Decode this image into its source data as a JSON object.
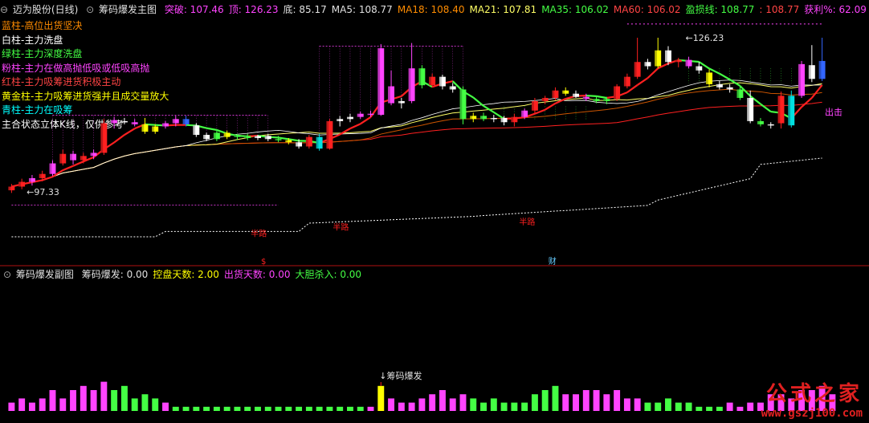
{
  "main_header": {
    "title": "迈为股份(日线)",
    "indicator_name": "筹码爆发主图",
    "items": [
      {
        "label": "突破:",
        "value": "107.46",
        "color": "#ff44ff"
      },
      {
        "label": "顶:",
        "value": "126.23",
        "color": "#ff44ff"
      },
      {
        "label": "底:",
        "value": "85.17",
        "color": "#e0e0e0"
      },
      {
        "label": "MA5:",
        "value": "108.77",
        "color": "#e0e0e0"
      },
      {
        "label": "MA18:",
        "value": "108.40",
        "color": "#ff8c00"
      },
      {
        "label": "MA21:",
        "value": "107.81",
        "color": "#ffff66"
      },
      {
        "label": "MA35:",
        "value": "106.02",
        "color": "#44ff44"
      },
      {
        "label": "MA60:",
        "value": "106.02",
        "color": "#ff4444"
      },
      {
        "label": "盈损线:",
        "value": "108.77",
        "color": "#44ff44"
      },
      {
        "label": ":",
        "value": "108.77",
        "color": "#ff4444"
      },
      {
        "label": "获利%:",
        "value": "62.09",
        "color": "#ff44ff"
      }
    ]
  },
  "legend": [
    {
      "text": "蓝柱-高位出货坚决",
      "color": "#ff8c00"
    },
    {
      "text": "白柱-主力洗盘",
      "color": "#ffffff"
    },
    {
      "text": "绿柱-主力深度洗盘",
      "color": "#44ff44"
    },
    {
      "text": "粉柱-主力在做高抛低吸或低吸高抛",
      "color": "#ff44ff"
    },
    {
      "text": "红柱-主力吸筹进货积极主动",
      "color": "#ff4444"
    },
    {
      "text": "黄金柱-主力吸筹进货强并且成交量放大",
      "color": "#ffff00"
    },
    {
      "text": "青柱-主力在吸筹",
      "color": "#00ffff"
    },
    {
      "text": "主合状态立体K线，仅供参考",
      "color": "#ffffff"
    }
  ],
  "sub_header": {
    "indicator_name": "筹码爆发副图",
    "items": [
      {
        "label": "筹码爆发:",
        "value": "0.00",
        "color": "#e0e0e0"
      },
      {
        "label": "控盘天数:",
        "value": "2.00",
        "color": "#ffff00"
      },
      {
        "label": "出货天数:",
        "value": "0.00",
        "color": "#ff44ff"
      },
      {
        "label": "大胆杀入:",
        "value": "0.00",
        "color": "#44ff44"
      }
    ]
  },
  "annotations": {
    "low_price": "97.33",
    "high_price": "126.23",
    "half_way_1": "半路",
    "half_way_2": "半路",
    "half_way_3": "半路",
    "dollar_marker": "$",
    "cai_marker": "财",
    "chu_ji": "出击",
    "burst_label": "筹码爆发"
  },
  "watermark": {
    "logo": "公式之家",
    "url": "www.gszj100.com"
  },
  "colors": {
    "ma_red": "#ff2020",
    "ma_green": "#44ff44",
    "ma_yellow": "#ffff66",
    "ma_orange": "#ff8c00",
    "magenta": "#ff44ff",
    "white": "#e0e0e0",
    "cyan": "#00e0e0",
    "divider": "#b01010"
  },
  "chart_data": [
    {
      "type": "candlestick",
      "title": "筹码爆发主图",
      "y_range": [
        85,
        130
      ],
      "candles": [
        {
          "o": 97.3,
          "h": 98.5,
          "l": 96.8,
          "c": 98.0,
          "color": "#ff2020"
        },
        {
          "o": 98.0,
          "h": 99.5,
          "l": 97.5,
          "c": 98.9,
          "color": "#ff2020"
        },
        {
          "o": 98.9,
          "h": 100.2,
          "l": 98.2,
          "c": 99.6,
          "color": "#ff44ff"
        },
        {
          "o": 99.6,
          "h": 101.0,
          "l": 99.0,
          "c": 100.4,
          "color": "#ff2020"
        },
        {
          "o": 100.4,
          "h": 103.0,
          "l": 100.0,
          "c": 102.4,
          "color": "#ff44ff"
        },
        {
          "o": 102.4,
          "h": 105.0,
          "l": 102.0,
          "c": 104.2,
          "color": "#ff2020"
        },
        {
          "o": 104.2,
          "h": 104.8,
          "l": 102.2,
          "c": 103.0,
          "color": "#ff44ff"
        },
        {
          "o": 103.0,
          "h": 104.4,
          "l": 102.4,
          "c": 103.8,
          "color": "#ff2020"
        },
        {
          "o": 103.8,
          "h": 105.0,
          "l": 103.2,
          "c": 104.4,
          "color": "#ff44ff"
        },
        {
          "o": 104.4,
          "h": 110.8,
          "l": 104.0,
          "c": 110.0,
          "color": "#ff2020"
        },
        {
          "o": 110.0,
          "h": 111.2,
          "l": 109.0,
          "c": 110.6,
          "color": "#ff44ff"
        },
        {
          "o": 110.4,
          "h": 111.0,
          "l": 109.8,
          "c": 110.2,
          "color": "#ffffff"
        },
        {
          "o": 110.2,
          "h": 110.8,
          "l": 109.4,
          "c": 109.8,
          "color": "#ff44ff"
        },
        {
          "o": 109.8,
          "h": 111.0,
          "l": 108.0,
          "c": 108.4,
          "color": "#ffff00"
        },
        {
          "o": 108.4,
          "h": 109.8,
          "l": 108.0,
          "c": 109.4,
          "color": "#ffff00"
        },
        {
          "o": 109.4,
          "h": 110.4,
          "l": 109.0,
          "c": 110.0,
          "color": "#ff44ff"
        },
        {
          "o": 110.0,
          "h": 111.4,
          "l": 109.4,
          "c": 110.8,
          "color": "#ff44ff"
        },
        {
          "o": 110.8,
          "h": 111.4,
          "l": 109.4,
          "c": 109.8,
          "color": "#3366ff"
        },
        {
          "o": 109.6,
          "h": 110.0,
          "l": 107.4,
          "c": 107.8,
          "color": "#ffffff"
        },
        {
          "o": 107.8,
          "h": 108.2,
          "l": 106.6,
          "c": 107.0,
          "color": "#ffffff"
        },
        {
          "o": 107.0,
          "h": 108.6,
          "l": 106.6,
          "c": 108.2,
          "color": "#44ff44"
        },
        {
          "o": 108.2,
          "h": 108.6,
          "l": 107.0,
          "c": 107.4,
          "color": "#ffff00"
        },
        {
          "o": 107.4,
          "h": 108.0,
          "l": 106.8,
          "c": 107.8,
          "color": "#44ff44"
        },
        {
          "o": 107.6,
          "h": 108.0,
          "l": 106.8,
          "c": 107.2,
          "color": "#44ff44"
        },
        {
          "o": 107.2,
          "h": 107.8,
          "l": 106.8,
          "c": 107.6,
          "color": "#ffffff"
        },
        {
          "o": 107.6,
          "h": 108.0,
          "l": 106.6,
          "c": 107.0,
          "color": "#ffffff"
        },
        {
          "o": 107.0,
          "h": 107.6,
          "l": 106.4,
          "c": 106.8,
          "color": "#44ff44"
        },
        {
          "o": 106.8,
          "h": 107.2,
          "l": 106.0,
          "c": 106.4,
          "color": "#ffff00"
        },
        {
          "o": 106.4,
          "h": 107.0,
          "l": 105.2,
          "c": 105.6,
          "color": "#ffffff"
        },
        {
          "o": 105.6,
          "h": 107.8,
          "l": 105.2,
          "c": 107.4,
          "color": "#ff2020"
        },
        {
          "o": 107.4,
          "h": 108.0,
          "l": 104.8,
          "c": 105.2,
          "color": "#00e0e0"
        },
        {
          "o": 105.2,
          "h": 110.8,
          "l": 105.0,
          "c": 110.4,
          "color": "#ff2020"
        },
        {
          "o": 110.4,
          "h": 111.4,
          "l": 109.4,
          "c": 110.8,
          "color": "#ffffff"
        },
        {
          "o": 110.8,
          "h": 111.8,
          "l": 110.2,
          "c": 111.2,
          "color": "#ffffff"
        },
        {
          "o": 111.2,
          "h": 112.2,
          "l": 110.8,
          "c": 111.8,
          "color": "#ff44ff"
        },
        {
          "o": 111.8,
          "h": 112.4,
          "l": 111.2,
          "c": 111.6,
          "color": "#ff44ff"
        },
        {
          "o": 111.6,
          "h": 125.0,
          "l": 111.4,
          "c": 124.2,
          "color": "#ff44ff"
        },
        {
          "o": 117.0,
          "h": 120.0,
          "l": 113.4,
          "c": 113.8,
          "color": "#ff44ff"
        },
        {
          "o": 113.8,
          "h": 114.8,
          "l": 112.8,
          "c": 114.2,
          "color": "#ffffff"
        },
        {
          "o": 114.2,
          "h": 125.2,
          "l": 113.8,
          "c": 120.4,
          "color": "#ff44ff"
        },
        {
          "o": 120.4,
          "h": 121.0,
          "l": 116.6,
          "c": 117.2,
          "color": "#44ff44"
        },
        {
          "o": 117.2,
          "h": 119.4,
          "l": 116.8,
          "c": 118.8,
          "color": "#ff2020"
        },
        {
          "o": 118.8,
          "h": 119.2,
          "l": 116.4,
          "c": 117.0,
          "color": "#ffffff"
        },
        {
          "o": 117.0,
          "h": 117.6,
          "l": 115.8,
          "c": 116.4,
          "color": "#ffffff"
        },
        {
          "o": 116.4,
          "h": 117.0,
          "l": 109.8,
          "c": 110.8,
          "color": "#44ff44"
        },
        {
          "o": 110.8,
          "h": 112.0,
          "l": 110.2,
          "c": 111.4,
          "color": "#ffff00"
        },
        {
          "o": 111.4,
          "h": 112.0,
          "l": 110.4,
          "c": 110.8,
          "color": "#44ff44"
        },
        {
          "o": 110.8,
          "h": 111.6,
          "l": 110.2,
          "c": 111.0,
          "color": "#ffffff"
        },
        {
          "o": 111.0,
          "h": 111.4,
          "l": 109.6,
          "c": 110.2,
          "color": "#ffffff"
        },
        {
          "o": 110.2,
          "h": 111.8,
          "l": 109.4,
          "c": 111.2,
          "color": "#ff2020"
        },
        {
          "o": 111.2,
          "h": 112.8,
          "l": 110.8,
          "c": 112.4,
          "color": "#ff44ff"
        },
        {
          "o": 112.4,
          "h": 114.8,
          "l": 111.8,
          "c": 114.2,
          "color": "#ff2020"
        },
        {
          "o": 114.2,
          "h": 115.2,
          "l": 113.6,
          "c": 114.8,
          "color": "#ff2020"
        },
        {
          "o": 114.8,
          "h": 116.8,
          "l": 114.4,
          "c": 116.2,
          "color": "#ff2020"
        },
        {
          "o": 116.2,
          "h": 116.8,
          "l": 115.2,
          "c": 115.6,
          "color": "#ffff00"
        },
        {
          "o": 115.6,
          "h": 116.2,
          "l": 114.8,
          "c": 115.0,
          "color": "#ffffff"
        },
        {
          "o": 115.0,
          "h": 115.6,
          "l": 114.2,
          "c": 114.6,
          "color": "#ff44ff"
        },
        {
          "o": 114.6,
          "h": 115.2,
          "l": 113.8,
          "c": 114.2,
          "color": "#44ff44"
        },
        {
          "o": 114.2,
          "h": 115.0,
          "l": 113.6,
          "c": 114.6,
          "color": "#44ff44"
        },
        {
          "o": 114.6,
          "h": 117.4,
          "l": 114.2,
          "c": 117.0,
          "color": "#ff2020"
        },
        {
          "o": 117.0,
          "h": 119.4,
          "l": 116.6,
          "c": 118.8,
          "color": "#ff2020"
        },
        {
          "o": 118.8,
          "h": 126.2,
          "l": 118.4,
          "c": 121.6,
          "color": "#ff2020"
        },
        {
          "o": 121.6,
          "h": 122.2,
          "l": 120.2,
          "c": 120.8,
          "color": "#ffffff"
        },
        {
          "o": 120.8,
          "h": 126.2,
          "l": 120.4,
          "c": 123.8,
          "color": "#ffff00"
        },
        {
          "o": 123.8,
          "h": 124.6,
          "l": 121.0,
          "c": 121.6,
          "color": "#ffffff"
        },
        {
          "o": 121.6,
          "h": 122.4,
          "l": 120.6,
          "c": 122.0,
          "color": "#ff2020"
        },
        {
          "o": 122.0,
          "h": 122.6,
          "l": 120.4,
          "c": 120.8,
          "color": "#ff44ff"
        },
        {
          "o": 120.8,
          "h": 121.6,
          "l": 119.4,
          "c": 120.0,
          "color": "#ffffff"
        },
        {
          "o": 119.6,
          "h": 120.2,
          "l": 116.8,
          "c": 117.4,
          "color": "#ffff00"
        },
        {
          "o": 117.4,
          "h": 118.0,
          "l": 116.4,
          "c": 116.8,
          "color": "#ffffff"
        },
        {
          "o": 116.8,
          "h": 117.4,
          "l": 115.8,
          "c": 116.4,
          "color": "#ffffff"
        },
        {
          "o": 116.4,
          "h": 117.0,
          "l": 114.4,
          "c": 114.8,
          "color": "#44ff44"
        },
        {
          "o": 114.8,
          "h": 116.2,
          "l": 110.0,
          "c": 110.4,
          "color": "#ffffff"
        },
        {
          "o": 110.4,
          "h": 111.0,
          "l": 109.4,
          "c": 109.8,
          "color": "#44ff44"
        },
        {
          "o": 109.8,
          "h": 110.2,
          "l": 109.0,
          "c": 109.6,
          "color": "#ffffff"
        },
        {
          "o": 110.0,
          "h": 116.0,
          "l": 109.0,
          "c": 115.2,
          "color": "#ff2020"
        },
        {
          "o": 115.2,
          "h": 116.2,
          "l": 109.2,
          "c": 109.6,
          "color": "#00e0e0"
        },
        {
          "o": 115.2,
          "h": 121.8,
          "l": 114.8,
          "c": 121.2,
          "color": "#ff44ff"
        },
        {
          "o": 121.0,
          "h": 124.8,
          "l": 117.8,
          "c": 118.4,
          "color": "#ffffff"
        },
        {
          "o": 118.4,
          "h": 126.2,
          "l": 118.0,
          "c": 121.8,
          "color": "#3366ff"
        }
      ],
      "annotations": {
        "high": "126.23",
        "low": "97.33"
      }
    },
    {
      "type": "bar",
      "title": "筹码爆发副图",
      "series": [
        {
          "values": [
            2,
            3,
            2,
            3,
            5,
            3,
            5,
            6,
            5,
            7,
            5,
            6,
            3,
            4,
            3,
            2,
            1,
            1,
            1,
            1,
            1,
            1,
            1,
            1,
            1,
            1,
            1,
            1,
            1,
            1,
            1,
            1,
            1,
            1,
            1,
            1,
            6,
            3,
            2,
            2,
            3,
            4,
            5,
            3,
            4,
            3,
            2,
            3,
            2,
            2,
            2,
            4,
            5,
            6,
            4,
            4,
            5,
            5,
            4,
            5,
            3,
            3,
            2,
            2,
            3,
            2,
            2,
            1,
            1,
            1,
            2,
            1,
            2,
            2,
            4,
            4,
            3,
            5,
            5,
            6,
            4
          ],
          "colors": [
            "#ff44ff",
            "#ff44ff",
            "#ff44ff",
            "#ff44ff",
            "#ff44ff",
            "#ff44ff",
            "#ff44ff",
            "#ff44ff",
            "#ff44ff",
            "#ff44ff",
            "#44ff44",
            "#44ff44",
            "#44ff44",
            "#44ff44",
            "#44ff44",
            "#ff44ff",
            "#44ff44",
            "#44ff44",
            "#44ff44",
            "#44ff44",
            "#44ff44",
            "#44ff44",
            "#44ff44",
            "#44ff44",
            "#44ff44",
            "#44ff44",
            "#44ff44",
            "#44ff44",
            "#44ff44",
            "#44ff44",
            "#44ff44",
            "#44ff44",
            "#44ff44",
            "#44ff44",
            "#44ff44",
            "#ff44ff",
            "#ffff00",
            "#ff44ff",
            "#ff44ff",
            "#ff44ff",
            "#ff44ff",
            "#ff44ff",
            "#ff44ff",
            "#ff44ff",
            "#ff44ff",
            "#44ff44",
            "#44ff44",
            "#44ff44",
            "#44ff44",
            "#44ff44",
            "#44ff44",
            "#44ff44",
            "#44ff44",
            "#44ff44",
            "#ff44ff",
            "#ff44ff",
            "#ff44ff",
            "#ff44ff",
            "#ff44ff",
            "#ff44ff",
            "#ff44ff",
            "#ff44ff",
            "#44ff44",
            "#44ff44",
            "#44ff44",
            "#44ff44",
            "#44ff44",
            "#44ff44",
            "#44ff44",
            "#44ff44",
            "#ff44ff",
            "#ff44ff",
            "#ff44ff",
            "#ff44ff",
            "#ff44ff",
            "#ff44ff",
            "#ff44ff",
            "#ff44ff",
            "#ff44ff",
            "#ff44ff",
            "#ff44ff"
          ]
        }
      ]
    }
  ]
}
